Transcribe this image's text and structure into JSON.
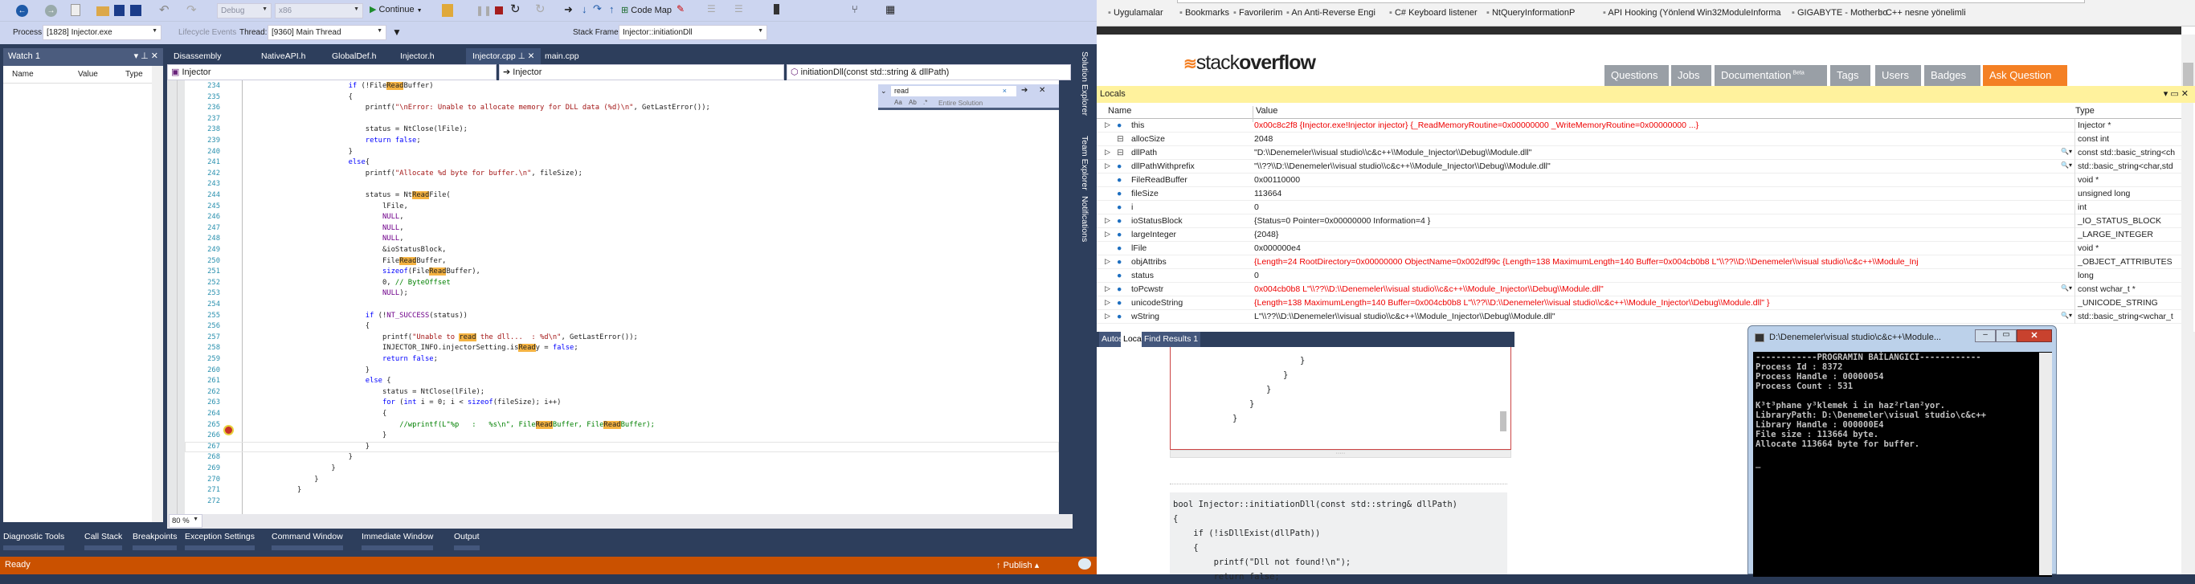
{
  "vs": {
    "toolbar": {
      "config": "Debug",
      "platform": "x86",
      "continue": "Continue",
      "code_map": "Code Map",
      "process_label": "Process:",
      "process_value": "[1828] Injector.exe",
      "lifecycle": "Lifecycle Events",
      "thread_label": "Thread:",
      "thread_value": "[9360] Main Thread",
      "stack_label": "Stack Frame:",
      "stack_value": "Injector::initiationDll"
    },
    "watch": {
      "title": "Watch 1",
      "columns": [
        "Name",
        "Value",
        "Type"
      ]
    },
    "editor": {
      "tabs": [
        "Disassembly",
        "NativeAPI.h",
        "GlobalDef.h",
        "Injector.h",
        "Injector.cpp",
        "main.cpp"
      ],
      "active_tab": "Injector.cpp",
      "nav_project": "Injector",
      "nav_scope": "Injector",
      "nav_member": "initiationDll(const std::string & dllPath)",
      "find_text": "read",
      "find_scope": "Entire Solution",
      "zoom": "80 %",
      "lines": [
        {
          "n": "234",
          "i": 3,
          "t": [
            [
              "k",
              "if"
            ],
            [
              "p",
              " (!File"
            ],
            [
              "h",
              "Read"
            ],
            [
              "p",
              "Buffer)"
            ]
          ]
        },
        {
          "n": "235",
          "i": 3,
          "t": [
            [
              "p",
              "{"
            ]
          ]
        },
        {
          "n": "236",
          "i": 4,
          "t": [
            [
              "p",
              "printf("
            ],
            [
              "s",
              "\"\\nError: Unable to allocate memory for DLL data (%d)\\n\""
            ],
            [
              "p",
              ", GetLastError());"
            ]
          ]
        },
        {
          "n": "237",
          "i": 0,
          "t": []
        },
        {
          "n": "238",
          "i": 4,
          "t": [
            [
              "p",
              "status = NtClose(lFile);"
            ]
          ]
        },
        {
          "n": "239",
          "i": 4,
          "t": [
            [
              "k",
              "return false"
            ],
            [
              "p",
              ";"
            ]
          ]
        },
        {
          "n": "240",
          "i": 3,
          "t": [
            [
              "p",
              "}"
            ]
          ]
        },
        {
          "n": "241",
          "i": 3,
          "t": [
            [
              "k",
              "else"
            ],
            [
              "p",
              "{"
            ]
          ]
        },
        {
          "n": "242",
          "i": 4,
          "t": [
            [
              "p",
              "printf("
            ],
            [
              "s",
              "\"Allocate %d byte for buffer.\\n\""
            ],
            [
              "p",
              ", fileSize);"
            ]
          ]
        },
        {
          "n": "243",
          "i": 0,
          "t": []
        },
        {
          "n": "244",
          "i": 4,
          "t": [
            [
              "p",
              "status = Nt"
            ],
            [
              "h",
              "Read"
            ],
            [
              "p",
              "File("
            ]
          ]
        },
        {
          "n": "245",
          "i": 5,
          "t": [
            [
              "p",
              "lFile,"
            ]
          ]
        },
        {
          "n": "246",
          "i": 5,
          "t": [
            [
              "m",
              "NULL"
            ],
            [
              "p",
              ","
            ]
          ]
        },
        {
          "n": "247",
          "i": 5,
          "t": [
            [
              "m",
              "NULL"
            ],
            [
              "p",
              ","
            ]
          ]
        },
        {
          "n": "248",
          "i": 5,
          "t": [
            [
              "m",
              "NULL"
            ],
            [
              "p",
              ","
            ]
          ]
        },
        {
          "n": "249",
          "i": 5,
          "t": [
            [
              "p",
              "&ioStatusBlock,"
            ]
          ]
        },
        {
          "n": "250",
          "i": 5,
          "t": [
            [
              "p",
              "File"
            ],
            [
              "h",
              "Read"
            ],
            [
              "p",
              "Buffer,"
            ]
          ]
        },
        {
          "n": "251",
          "i": 5,
          "t": [
            [
              "k",
              "sizeof"
            ],
            [
              "p",
              "(File"
            ],
            [
              "h",
              "Read"
            ],
            [
              "p",
              "Buffer),"
            ]
          ]
        },
        {
          "n": "252",
          "i": 5,
          "t": [
            [
              "p",
              "0, "
            ],
            [
              "c",
              "// ByteOffset"
            ]
          ]
        },
        {
          "n": "253",
          "i": 5,
          "t": [
            [
              "m",
              "NULL"
            ],
            [
              "p",
              ");"
            ]
          ]
        },
        {
          "n": "254",
          "i": 0,
          "t": []
        },
        {
          "n": "255",
          "i": 4,
          "t": [
            [
              "k",
              "if"
            ],
            [
              "p",
              " (!"
            ],
            [
              "m",
              "NT_SUCCESS"
            ],
            [
              "p",
              "(status))"
            ]
          ]
        },
        {
          "n": "256",
          "i": 4,
          "t": [
            [
              "p",
              "{"
            ]
          ]
        },
        {
          "n": "257",
          "i": 5,
          "t": [
            [
              "p",
              "printf("
            ],
            [
              "s",
              "\"Unable to "
            ],
            [
              "h",
              "read"
            ],
            [
              "s",
              " the dll...  : %d\\n\""
            ],
            [
              "p",
              ", GetLastError());"
            ]
          ]
        },
        {
          "n": "258",
          "i": 5,
          "t": [
            [
              "p",
              "INJECTOR_INFO.injectorSetting.is"
            ],
            [
              "h",
              "Read"
            ],
            [
              "p",
              "y = "
            ],
            [
              "k",
              "false"
            ],
            [
              "p",
              ";"
            ]
          ]
        },
        {
          "n": "259",
          "i": 5,
          "t": [
            [
              "k",
              "return false"
            ],
            [
              "p",
              ";"
            ]
          ]
        },
        {
          "n": "260",
          "i": 4,
          "t": [
            [
              "p",
              "}"
            ]
          ]
        },
        {
          "n": "261",
          "i": 4,
          "t": [
            [
              "k",
              "else"
            ],
            [
              "p",
              " {"
            ]
          ]
        },
        {
          "n": "262",
          "i": 5,
          "t": [
            [
              "p",
              "status = NtClose(lFile);"
            ]
          ]
        },
        {
          "n": "263",
          "i": 5,
          "t": [
            [
              "k",
              "for"
            ],
            [
              "p",
              " ("
            ],
            [
              "k",
              "int"
            ],
            [
              "p",
              " i = 0; i < "
            ],
            [
              "k",
              "sizeof"
            ],
            [
              "p",
              "(fileSize); i++)"
            ]
          ]
        },
        {
          "n": "264",
          "i": 5,
          "t": [
            [
              "p",
              "{"
            ]
          ]
        },
        {
          "n": "265",
          "i": 6,
          "t": [
            [
              "c",
              "//wprintf(L\"%p   :   %s\\n\", File"
            ],
            [
              "h",
              "Read"
            ],
            [
              "c",
              "Buffer, File"
            ],
            [
              "h",
              "Read"
            ],
            [
              "c",
              "Buffer);"
            ]
          ]
        },
        {
          "n": "266",
          "i": 5,
          "t": [
            [
              "p",
              "}"
            ]
          ]
        },
        {
          "n": "267",
          "i": 4,
          "t": [
            [
              "p",
              "}"
            ]
          ]
        },
        {
          "n": "268",
          "i": 3,
          "t": [
            [
              "p",
              "}"
            ]
          ]
        },
        {
          "n": "269",
          "i": 2,
          "t": [
            [
              "p",
              "}"
            ]
          ]
        },
        {
          "n": "270",
          "i": 1,
          "t": [
            [
              "p",
              "}"
            ]
          ]
        },
        {
          "n": "271",
          "i": 0,
          "t": [
            [
              "p",
              "}"
            ]
          ]
        },
        {
          "n": "272",
          "i": 0,
          "t": []
        }
      ]
    },
    "side_tabs": [
      "Solution Explorer",
      "Team Explorer",
      "Notifications"
    ],
    "bottom_tabs": [
      "Diagnostic Tools",
      "Call Stack",
      "Breakpoints",
      "Exception Settings",
      "Command Window",
      "Immediate Window",
      "Output"
    ],
    "status": "Ready",
    "publish": "Publish"
  },
  "browser": {
    "bookmarks": [
      "Uygulamalar",
      "Bookmarks",
      "Favorilerim",
      "An Anti-Reverse Engi",
      "C# Keyboard listener",
      "NtQueryInformationP",
      "API Hooking (Yönlend",
      "Win32ModuleInforma",
      "GIGABYTE - Motherbo",
      "C++ nesne yönelimli"
    ],
    "logo_light": "stack",
    "logo_bold": "overflow",
    "nav": [
      "Questions",
      "Jobs",
      "Documentation",
      "Tags",
      "Users",
      "Badges"
    ],
    "nav_beta": "Beta",
    "ask": "Ask Question",
    "accent": "#f48024",
    "braces": [
      "}",
      "}",
      "}",
      "}",
      "}"
    ],
    "snippet": [
      "bool Injector::initiationDll(const std::string& dllPath)",
      "{",
      "    if (!isDllExist(dllPath))",
      "    {",
      "        printf(\"Dll not found!\\n\");",
      "        return false;"
    ]
  },
  "locals": {
    "title": "Locals",
    "columns": [
      "Name",
      "Value",
      "Type"
    ],
    "rows": [
      {
        "name": "this",
        "value": "0x00c8c2f8 {Injector.exe!Injector injector} {_ReadMemoryRoutine=0x00000000 _WriteMemoryRoutine=0x00000000 ...}",
        "type": "Injector *",
        "exp": true,
        "red": true,
        "icon": "field",
        "mag": false
      },
      {
        "name": "allocSize",
        "value": "2048",
        "type": "const int",
        "exp": false,
        "red": false,
        "icon": "const",
        "mag": false
      },
      {
        "name": "dllPath",
        "value": "\"D:\\\\Denemeler\\\\visual studio\\\\c&c++\\\\Module_Injector\\\\Debug\\\\Module.dll\"",
        "type": "const std::basic_string<ch",
        "exp": true,
        "red": false,
        "icon": "const",
        "mag": true
      },
      {
        "name": "dllPathWithprefix",
        "value": "\"\\\\??\\\\D:\\\\Denemeler\\\\visual studio\\\\c&c++\\\\Module_Injector\\\\Debug\\\\Module.dll\"",
        "type": "std::basic_string<char,std",
        "exp": true,
        "red": false,
        "icon": "field",
        "mag": true
      },
      {
        "name": "FileReadBuffer",
        "value": "0x00110000",
        "type": "void *",
        "exp": false,
        "red": false,
        "icon": "field",
        "mag": false
      },
      {
        "name": "fileSize",
        "value": "113664",
        "type": "unsigned long",
        "exp": false,
        "red": false,
        "icon": "field",
        "mag": false
      },
      {
        "name": "i",
        "value": "0",
        "type": "int",
        "exp": false,
        "red": false,
        "icon": "field",
        "mag": false
      },
      {
        "name": "ioStatusBlock",
        "value": "{Status=0 Pointer=0x00000000 Information=4 }",
        "type": "_IO_STATUS_BLOCK",
        "exp": true,
        "red": false,
        "icon": "field",
        "mag": false
      },
      {
        "name": "largeInteger",
        "value": "{2048}",
        "type": "_LARGE_INTEGER",
        "exp": true,
        "red": false,
        "icon": "field",
        "mag": false
      },
      {
        "name": "lFile",
        "value": "0x000000e4",
        "type": "void *",
        "exp": false,
        "red": false,
        "icon": "field",
        "mag": false
      },
      {
        "name": "objAttribs",
        "value": "{Length=24 RootDirectory=0x00000000 ObjectName=0x002df99c {Length=138 MaximumLength=140 Buffer=0x004cb0b8 L\"\\\\??\\\\D:\\\\Denemeler\\\\visual studio\\\\c&c++\\\\Module_Inj",
        "type": "_OBJECT_ATTRIBUTES",
        "exp": true,
        "red": true,
        "icon": "field",
        "mag": false
      },
      {
        "name": "status",
        "value": "0",
        "type": "long",
        "exp": false,
        "red": false,
        "icon": "field",
        "mag": false
      },
      {
        "name": "toPcwstr",
        "value": "0x004cb0b8 L\"\\\\??\\\\D:\\\\Denemeler\\\\visual studio\\\\c&c++\\\\Module_Injector\\\\Debug\\\\Module.dll\"",
        "type": "const wchar_t *",
        "exp": true,
        "red": true,
        "icon": "field",
        "mag": true
      },
      {
        "name": "unicodeString",
        "value": "{Length=138 MaximumLength=140 Buffer=0x004cb0b8 L\"\\\\??\\\\D:\\\\Denemeler\\\\visual studio\\\\c&c++\\\\Module_Injector\\\\Debug\\\\Module.dll\" }",
        "type": "_UNICODE_STRING",
        "exp": true,
        "red": true,
        "icon": "field",
        "mag": false
      },
      {
        "name": "wString",
        "value": "L\"\\\\??\\\\D:\\\\Denemeler\\\\visual studio\\\\c&c++\\\\Module_Injector\\\\Debug\\\\Module.dll\"",
        "type": "std::basic_string<wchar_t",
        "exp": true,
        "red": false,
        "icon": "field",
        "mag": true
      }
    ],
    "tabs": [
      "Autos",
      "Locals",
      "Find Results 1"
    ],
    "active_tab": "Locals"
  },
  "console": {
    "title": "D:\\Denemeler\\visual studio\\c&c++\\Module...",
    "lines": [
      "------------PROGRAMIN BAİLANGICI------------",
      "Process Id : 8372",
      "Process Handle : 00000054",
      "Process Count : 531",
      "",
      "K³t³phane y³klemek i in haz²rlan²yor.",
      "LibraryPath: D:\\Denemeler\\visual studio\\c&c++",
      "Library Handle : 000000E4",
      "File size : 113664 byte.",
      "Allocate 113664 byte for buffer.",
      "",
      "_"
    ]
  }
}
